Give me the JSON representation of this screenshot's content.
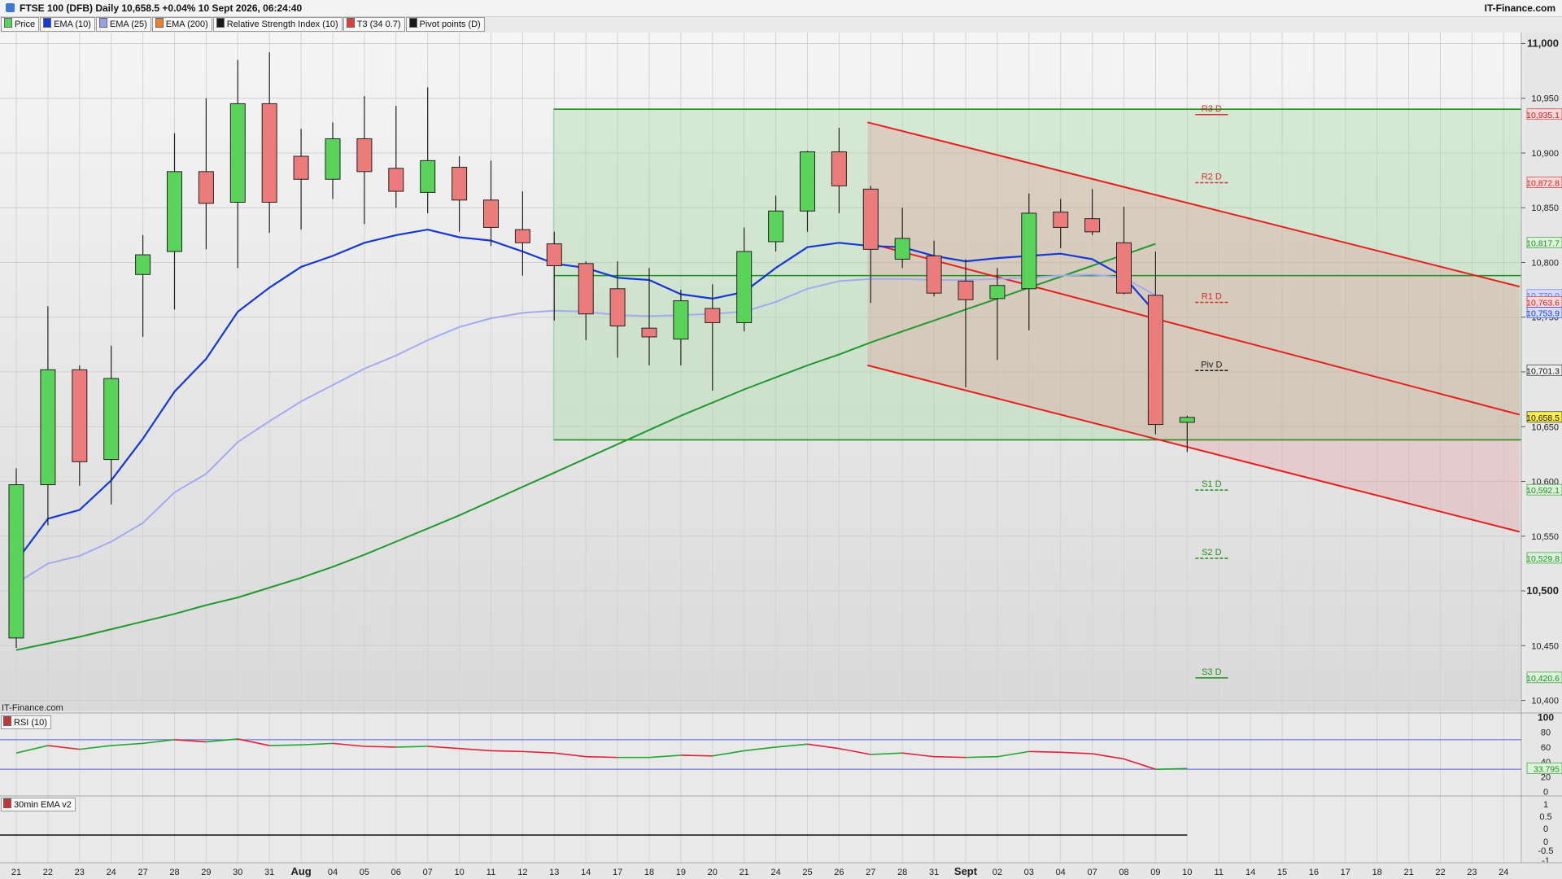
{
  "header": {
    "title": "FTSE 100 (DFB) Daily 10,658.5 +0.04% 10 Sept 2026, 06:24:40",
    "brand": "IT-Finance.com"
  },
  "legend": [
    {
      "label": "Price",
      "color": "#5ad35a"
    },
    {
      "label": "EMA (10)",
      "color": "#1538d6"
    },
    {
      "label": "EMA (25)",
      "color": "#9aa0f0"
    },
    {
      "label": "EMA (200)",
      "color": "#f07e2a"
    },
    {
      "label": "Relative Strength Index (10)",
      "color": "#1a1a1a"
    },
    {
      "label": "T3 (34 0.7)",
      "color": "#e23b3b"
    },
    {
      "label": "Pivot points (D)",
      "color": "#1a1a1a"
    }
  ],
  "watermark": "IT-Finance.com",
  "rsi_panel": {
    "label": "RSI (10)"
  },
  "ema_panel": {
    "label": "30min EMA v2"
  },
  "chart_data": {
    "type": "candlestick",
    "x_ticks": [
      "21",
      "22",
      "23",
      "24",
      "27",
      "28",
      "29",
      "30",
      "31",
      "Aug",
      "04",
      "05",
      "06",
      "07",
      "10",
      "11",
      "12",
      "13",
      "14",
      "17",
      "18",
      "19",
      "20",
      "21",
      "24",
      "25",
      "26",
      "27",
      "28",
      "31",
      "Sept",
      "02",
      "03",
      "04",
      "07",
      "08",
      "09",
      "10",
      "11",
      "14",
      "15",
      "16",
      "17",
      "18",
      "21",
      "22",
      "23",
      "24"
    ],
    "bold_ticks": [
      "Aug",
      "Sept"
    ],
    "y_ticks": [
      {
        "v": 11000,
        "label": "11,000",
        "bold": true
      },
      {
        "v": 10950,
        "label": "10,950",
        "bold": false
      },
      {
        "v": 10900,
        "label": "10,900",
        "bold": false
      },
      {
        "v": 10850,
        "label": "10,850",
        "bold": false
      },
      {
        "v": 10800,
        "label": "10,800",
        "bold": false
      },
      {
        "v": 10750,
        "label": "10,750",
        "bold": false
      },
      {
        "v": 10700,
        "label": "10,700",
        "bold": false
      },
      {
        "v": 10650,
        "label": "10,650",
        "bold": false
      },
      {
        "v": 10600,
        "label": "10,600",
        "bold": false
      },
      {
        "v": 10550,
        "label": "10,550",
        "bold": false
      },
      {
        "v": 10500,
        "label": "10,500",
        "bold": true
      },
      {
        "v": 10450,
        "label": "10,450",
        "bold": false
      },
      {
        "v": 10400,
        "label": "10,400",
        "bold": false
      }
    ],
    "ylim": [
      10390,
      11010
    ],
    "candles": [
      {
        "x": "21",
        "o": 10457,
        "h": 10612,
        "l": 10448,
        "c": 10597
      },
      {
        "x": "22",
        "o": 10597,
        "h": 10760,
        "l": 10560,
        "c": 10702
      },
      {
        "x": "23",
        "o": 10702,
        "h": 10706,
        "l": 10596,
        "c": 10618
      },
      {
        "x": "24",
        "o": 10620,
        "h": 10724,
        "l": 10579,
        "c": 10694
      },
      {
        "x": "27",
        "o": 10789,
        "h": 10825,
        "l": 10732,
        "c": 10807
      },
      {
        "x": "28",
        "o": 10810,
        "h": 10918,
        "l": 10757,
        "c": 10883
      },
      {
        "x": "29",
        "o": 10883,
        "h": 10950,
        "l": 10812,
        "c": 10854
      },
      {
        "x": "30",
        "o": 10855,
        "h": 10985,
        "l": 10795,
        "c": 10945
      },
      {
        "x": "31",
        "o": 10945,
        "h": 10992,
        "l": 10827,
        "c": 10855
      },
      {
        "x": "Aug",
        "o": 10897,
        "h": 10922,
        "l": 10830,
        "c": 10876
      },
      {
        "x": "04",
        "o": 10876,
        "h": 10928,
        "l": 10858,
        "c": 10913
      },
      {
        "x": "05",
        "o": 10913,
        "h": 10952,
        "l": 10835,
        "c": 10883
      },
      {
        "x": "06",
        "o": 10886,
        "h": 10943,
        "l": 10850,
        "c": 10865
      },
      {
        "x": "07",
        "o": 10864,
        "h": 10960,
        "l": 10845,
        "c": 10893
      },
      {
        "x": "10",
        "o": 10887,
        "h": 10897,
        "l": 10828,
        "c": 10857
      },
      {
        "x": "11",
        "o": 10857,
        "h": 10893,
        "l": 10815,
        "c": 10832
      },
      {
        "x": "12",
        "o": 10830,
        "h": 10865,
        "l": 10788,
        "c": 10818
      },
      {
        "x": "13",
        "o": 10817,
        "h": 10828,
        "l": 10747,
        "c": 10797
      },
      {
        "x": "14",
        "o": 10799,
        "h": 10801,
        "l": 10729,
        "c": 10753
      },
      {
        "x": "17",
        "o": 10776,
        "h": 10801,
        "l": 10713,
        "c": 10742
      },
      {
        "x": "18",
        "o": 10740,
        "h": 10795,
        "l": 10706,
        "c": 10732
      },
      {
        "x": "19",
        "o": 10730,
        "h": 10775,
        "l": 10706,
        "c": 10765
      },
      {
        "x": "20",
        "o": 10758,
        "h": 10780,
        "l": 10683,
        "c": 10745
      },
      {
        "x": "21",
        "o": 10745,
        "h": 10832,
        "l": 10737,
        "c": 10810
      },
      {
        "x": "24",
        "o": 10819,
        "h": 10861,
        "l": 10810,
        "c": 10847
      },
      {
        "x": "25",
        "o": 10847,
        "h": 10902,
        "l": 10828,
        "c": 10901
      },
      {
        "x": "26",
        "o": 10901,
        "h": 10923,
        "l": 10845,
        "c": 10870
      },
      {
        "x": "27",
        "o": 10867,
        "h": 10870,
        "l": 10763,
        "c": 10812
      },
      {
        "x": "28",
        "o": 10803,
        "h": 10850,
        "l": 10795,
        "c": 10822
      },
      {
        "x": "31",
        "o": 10806,
        "h": 10820,
        "l": 10769,
        "c": 10772
      },
      {
        "x": "Sept",
        "o": 10783,
        "h": 10803,
        "l": 10686,
        "c": 10766
      },
      {
        "x": "02",
        "o": 10767,
        "h": 10795,
        "l": 10711,
        "c": 10779
      },
      {
        "x": "03",
        "o": 10776,
        "h": 10863,
        "l": 10738,
        "c": 10845
      },
      {
        "x": "04",
        "o": 10846,
        "h": 10858,
        "l": 10813,
        "c": 10832
      },
      {
        "x": "07",
        "o": 10840,
        "h": 10867,
        "l": 10825,
        "c": 10828
      },
      {
        "x": "08",
        "o": 10818,
        "h": 10851,
        "l": 10771,
        "c": 10772
      },
      {
        "x": "09",
        "o": 10770,
        "h": 10810,
        "l": 10643,
        "c": 10652
      },
      {
        "x": "10",
        "o": 10654,
        "h": 10660,
        "l": 10627,
        "c": 10658.5
      }
    ],
    "ema10": [
      10527,
      10566,
      10574,
      10601,
      10639,
      10682,
      10712,
      10755,
      10777,
      10796,
      10806,
      10818,
      10825,
      10830,
      10823,
      10820,
      10810,
      10799,
      10795,
      10786,
      10784,
      10771,
      10767,
      10773,
      10795,
      10814,
      10818,
      10815,
      10814,
      10806,
      10801,
      10804,
      10806,
      10808,
      10803,
      10787,
      10754
    ],
    "ema25": [
      10507,
      10525,
      10532,
      10545,
      10562,
      10590,
      10607,
      10636,
      10655,
      10673,
      10688,
      10703,
      10715,
      10729,
      10741,
      10749,
      10754,
      10756,
      10755,
      10752,
      10751,
      10752,
      10753,
      10755,
      10764,
      10776,
      10783,
      10785,
      10785,
      10784,
      10784,
      10785,
      10786,
      10788,
      10789,
      10786,
      10770
    ],
    "ema200": [
      10446,
      10452,
      10458,
      10465,
      10472,
      10479,
      10487,
      10494,
      10503,
      10512,
      10522,
      10533,
      10545,
      10557,
      10569,
      10582,
      10595,
      10608,
      10621,
      10634,
      10647,
      10660,
      10672,
      10684,
      10695,
      10706,
      10716,
      10727,
      10737,
      10747,
      10757,
      10767,
      10777,
      10787,
      10797,
      10807,
      10817
    ],
    "last_price": 10658.5,
    "pivots": [
      {
        "label": "R3 D",
        "v": 10935.1,
        "color": "#d62b2b"
      },
      {
        "label": "R2 D",
        "v": 10872.8,
        "color": "#d62b2b"
      },
      {
        "label": "R1 D",
        "v": 10763.6,
        "color": "#d62b2b"
      },
      {
        "label": "Piv D",
        "v": 10701.3,
        "color": "#1a1a1a"
      },
      {
        "label": "S1 D",
        "v": 10592.1,
        "color": "#1f8f1f"
      },
      {
        "label": "S2 D",
        "v": 10529.8,
        "color": "#1f8f1f"
      },
      {
        "label": "S3 D",
        "v": 10420.6,
        "color": "#1f8f1f"
      }
    ],
    "price_tags": [
      {
        "label": "10,935.1",
        "v": 10935.1,
        "bg": "#ffd9d9",
        "fg": "#c41f1f"
      },
      {
        "label": "10,872.8",
        "v": 10872.8,
        "bg": "#ffd9d9",
        "fg": "#c41f1f"
      },
      {
        "label": "10,817.7",
        "v": 10817.7,
        "bg": "#dcf3dc",
        "fg": "#1f8f1f"
      },
      {
        "label": "10,770.0",
        "v": 10770,
        "bg": "#d6dcff",
        "fg": "#6070e0"
      },
      {
        "label": "10,763.6",
        "v": 10763.6,
        "bg": "#ffd9d9",
        "fg": "#c41f1f"
      },
      {
        "label": "10,753.9",
        "v": 10753.9,
        "bg": "#d6dcff",
        "fg": "#1538d6"
      },
      {
        "label": "10,701.3",
        "v": 10701.3,
        "bg": "#eeeeee",
        "fg": "#111111"
      },
      {
        "label": "10,658.5",
        "v": 10658.5,
        "bg": "#fff14a",
        "fg": "#111111"
      },
      {
        "label": "10,592.1",
        "v": 10592.1,
        "bg": "#dcf3dc",
        "fg": "#1f8f1f"
      },
      {
        "label": "10,529.8",
        "v": 10529.8,
        "bg": "#dcf3dc",
        "fg": "#1f8f1f"
      },
      {
        "label": "10,420.6",
        "v": 10420.6,
        "bg": "#dcf3dc",
        "fg": "#1f8f1f"
      }
    ],
    "green_box": {
      "x_from": 17,
      "upper": 10940,
      "lower": 10638,
      "mid": 10788
    },
    "channel": {
      "x_from": 26.9,
      "x_to": 47.5,
      "upper": [
        10928,
        10778
      ],
      "middle": [
        10818,
        10661
      ],
      "lower": [
        10706,
        10554
      ]
    },
    "rsi": {
      "label": "RSI (10)",
      "ylim": [
        -5,
        105
      ],
      "ticks": [
        100,
        80,
        60,
        40,
        20,
        0
      ],
      "upper_band": 70,
      "lower_band": 30,
      "values": [
        52,
        62,
        57,
        62,
        65,
        70,
        67,
        71,
        62,
        63,
        65,
        61,
        60,
        61,
        58,
        55,
        54,
        52,
        47,
        46,
        46,
        49,
        48,
        55,
        60,
        64,
        58,
        50,
        52,
        47,
        46,
        47,
        54,
        53,
        51,
        44,
        30,
        31
      ],
      "last_label": "33.795"
    },
    "ema_v2": {
      "label": "30min EMA v2",
      "ticks": [
        {
          "v": 1,
          "label": "1"
        },
        {
          "v": 0.5,
          "label": "0.5"
        },
        {
          "v": 0,
          "label": "0"
        },
        {
          "v": 0,
          "label": "0"
        },
        {
          "v": -0.5,
          "label": "-0.5"
        },
        {
          "v": -1,
          "label": "-1"
        }
      ]
    }
  }
}
